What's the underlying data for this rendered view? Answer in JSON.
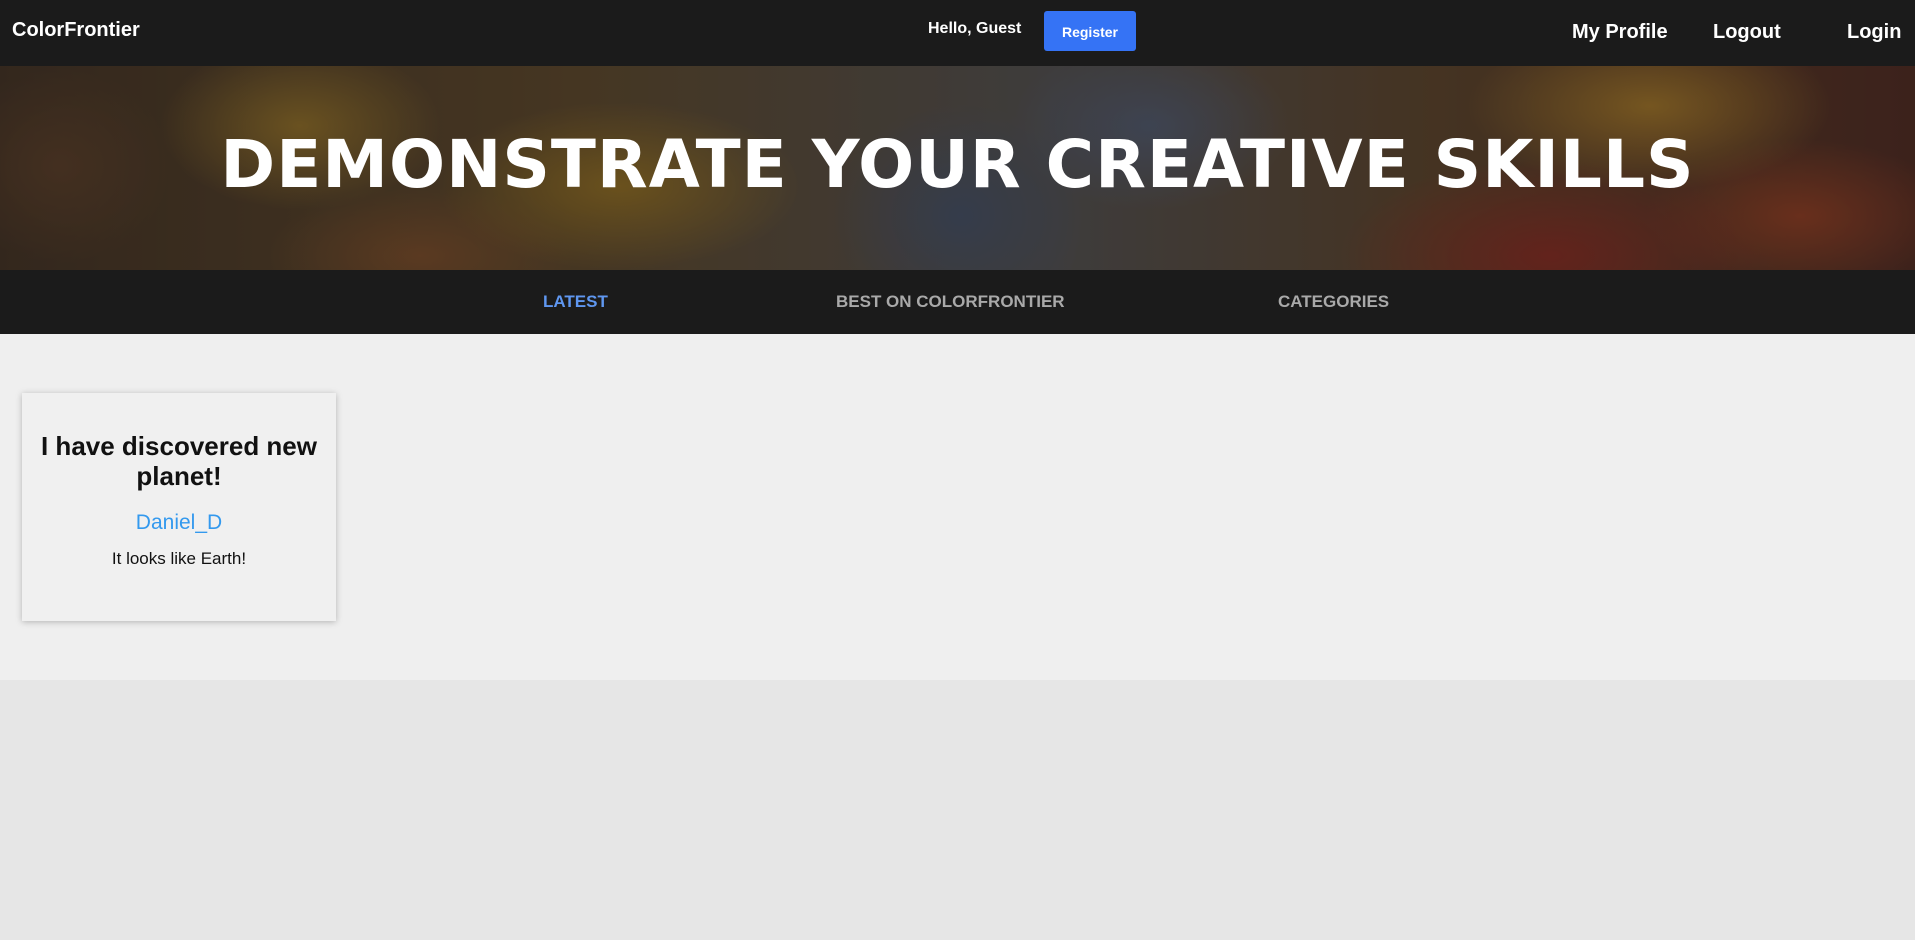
{
  "header": {
    "brand": "ColorFrontier",
    "greeting": "Hello, Guest",
    "register_label": "Register",
    "links": {
      "profile": "My Profile",
      "logout": "Logout",
      "login": "Login"
    }
  },
  "hero": {
    "title": "DEMONSTRATE YOUR CREATIVE SKILLS"
  },
  "subnav": {
    "tabs": [
      {
        "label": "LATEST",
        "active": true
      },
      {
        "label": "BEST ON COLORFRONTIER",
        "active": false
      },
      {
        "label": "CATEGORIES",
        "active": false
      }
    ]
  },
  "posts": [
    {
      "title": "I have discovered new planet!",
      "author": "Daniel_D",
      "text": "It looks like Earth!"
    }
  ],
  "colors": {
    "accent": "#3573f5",
    "active_tab": "#5f97f0",
    "author_link": "#3399ee",
    "topbar": "#1b1b1b"
  }
}
